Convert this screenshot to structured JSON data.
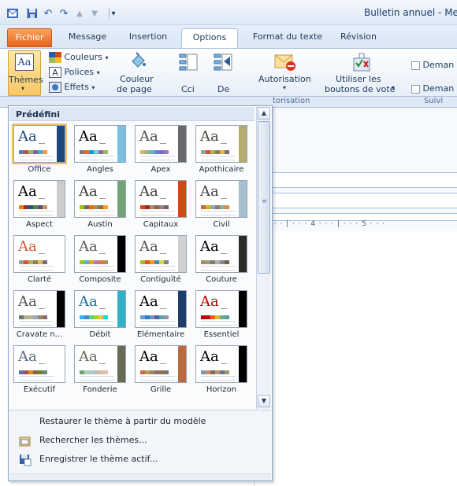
{
  "window": {
    "title": "Bulletin annuel - Me"
  },
  "tabs": [
    {
      "label": "Fichier"
    },
    {
      "label": "Message"
    },
    {
      "label": "Insertion"
    },
    {
      "label": "Options"
    },
    {
      "label": "Format du texte"
    },
    {
      "label": "Révision"
    }
  ],
  "ribbon": {
    "themes_label": "Thèmes",
    "colors_label": "Couleurs",
    "fonts_label": "Polices",
    "effects_label": "Effets",
    "page_color_line1": "Couleur",
    "page_color_line2": "de page",
    "cci_label": "Cci",
    "de_label": "De",
    "authorisation_label": "Autorisation",
    "vote_line1": "Utiliser les",
    "vote_line2": "boutons de vote",
    "demand1": "Deman",
    "demand2": "Deman",
    "group_authorisation": "torisation",
    "group_suivi": "Suivi"
  },
  "gallery": {
    "header": "Prédéfini",
    "themes": [
      {
        "label": "Office",
        "aa_color": "#1f497d",
        "side": "#1f497d",
        "swatches": [
          "#4f81bd",
          "#c0504d",
          "#9bbb59",
          "#8064a2",
          "#4bacc6",
          "#f79646"
        ]
      },
      {
        "label": "Angles",
        "aa_color": "#000000",
        "side": "#7ac0e3",
        "swatches": [
          "#797b7e",
          "#f96a1b",
          "#08a1d9",
          "#7cc7e2",
          "#8a6c9a",
          "#9bbb59"
        ]
      },
      {
        "label": "Apex",
        "aa_color": "#4b4d50",
        "side": "#69676d",
        "swatches": [
          "#ceb966",
          "#9cb084",
          "#6bb1c9",
          "#6585cf",
          "#7e6bc9",
          "#a379bb"
        ]
      },
      {
        "label": "Apothicaire",
        "aa_color": "#4f4a3e",
        "side": "#b3ab6f",
        "swatches": [
          "#93a299",
          "#cf543f",
          "#b5ae53",
          "#848058",
          "#e8b54d",
          "#786c71"
        ]
      },
      {
        "label": "Aspect",
        "aa_color": "#000000",
        "side": "#cccccc",
        "swatches": [
          "#f07f09",
          "#9f2936",
          "#1b587c",
          "#4e8542",
          "#604878",
          "#c19859"
        ]
      },
      {
        "label": "Austin",
        "aa_color": "#3b3b3b",
        "side": "#72a376",
        "swatches": [
          "#94c600",
          "#71685a",
          "#ff6700",
          "#909465",
          "#956b43",
          "#fea022"
        ]
      },
      {
        "label": "Capitaux",
        "aa_color": "#3f3f3f",
        "side": "#d34817",
        "swatches": [
          "#d34817",
          "#9b2d1f",
          "#a28e6a",
          "#956251",
          "#918485",
          "#855d5d"
        ]
      },
      {
        "label": "Civil",
        "aa_color": "#454545",
        "side": "#a5c0d0",
        "swatches": [
          "#d16349",
          "#ccb400",
          "#8cadae",
          "#8c7b70",
          "#8fb08c",
          "#d19049"
        ]
      },
      {
        "label": "Clarté",
        "aa_color": "#d15c3b",
        "side": "#ffffff",
        "swatches": [
          "#93a299",
          "#cf543f",
          "#b5ae53",
          "#848058",
          "#e8b54d",
          "#786c71"
        ]
      },
      {
        "label": "Composite",
        "aa_color": "#5c5c5c",
        "side": "#000000",
        "swatches": [
          "#98c723",
          "#59b0b9",
          "#deae00",
          "#b77bb4",
          "#e0773c",
          "#a98d63"
        ]
      },
      {
        "label": "Contiguïté",
        "aa_color": "#555555",
        "side": "#d1d1d1",
        "swatches": [
          "#a6b727",
          "#df5327",
          "#fe9e00",
          "#418ab3",
          "#d7d447",
          "#818183"
        ]
      },
      {
        "label": "Couture",
        "aa_color": "#000000",
        "side": "#2b2b2b",
        "swatches": [
          "#9e8e5c",
          "#a09781",
          "#85776d",
          "#aeafa9",
          "#8d878b",
          "#6b6149"
        ]
      },
      {
        "label": "Cravate n...",
        "aa_color": "#555555",
        "side": "#000000",
        "swatches": [
          "#6f6f74",
          "#a7b789",
          "#beae98",
          "#92a9b9",
          "#9c8265",
          "#8d6974"
        ]
      },
      {
        "label": "Débit",
        "aa_color": "#1e6e99",
        "side": "#2fb2c8",
        "swatches": [
          "#31b6fd",
          "#4584d3",
          "#5bd078",
          "#a5d028",
          "#f5c040",
          "#05e0db"
        ]
      },
      {
        "label": "Élémentaire",
        "aa_color": "#000000",
        "side": "#1f3d69",
        "swatches": [
          "#629dd1",
          "#297fd5",
          "#7f8fa9",
          "#4a66ac",
          "#5aa2ae",
          "#9d90a0"
        ]
      },
      {
        "label": "Essentiel",
        "aa_color": "#c00000",
        "side": "#000000",
        "swatches": [
          "#c00000",
          "#b01513",
          "#ea6312",
          "#e6b729",
          "#6aac90",
          "#5f9c9d"
        ]
      },
      {
        "label": "Exécutif",
        "aa_color": "#5a6b80",
        "side": "#ffffff",
        "swatches": [
          "#6076b4",
          "#9c5252",
          "#e68422",
          "#846648",
          "#63891f",
          "#758085"
        ]
      },
      {
        "label": "Fonderie",
        "aa_color": "#676a55",
        "side": "#676a55",
        "swatches": [
          "#72a376",
          "#b0ccb0",
          "#a8cdd7",
          "#c0beaf",
          "#cec597",
          "#e8b7b7"
        ]
      },
      {
        "label": "Grille",
        "aa_color": "#000000",
        "side": "#b96a43",
        "swatches": [
          "#c66951",
          "#bf974d",
          "#928b70",
          "#87706b",
          "#94734e",
          "#6f777d"
        ]
      },
      {
        "label": "Horizon",
        "aa_color": "#000000",
        "side": "#000000",
        "swatches": [
          "#7e97ad",
          "#cc8e60",
          "#7a6a60",
          "#b4936d",
          "#67787b",
          "#9d936f"
        ]
      }
    ]
  },
  "menu": {
    "restore": "Restaurer le thème à partir du modèle",
    "search": "Rechercher les thèmes...",
    "save": "Enregistrer le thème actif..."
  },
  "ruler": {
    "text": "· · · | · · · 4 · · · | · · · 5 · · ·"
  },
  "icons": [
    "save-icon",
    "undo-icon",
    "redo-icon",
    "up-arrow-icon",
    "down-arrow-icon",
    "themes-icon",
    "colors-icon",
    "fonts-icon",
    "effects-icon",
    "page-color-icon",
    "cci-icon",
    "de-icon",
    "authorisation-icon",
    "vote-icon",
    "checkbox-icon",
    "folder-search-icon",
    "save-theme-icon"
  ]
}
